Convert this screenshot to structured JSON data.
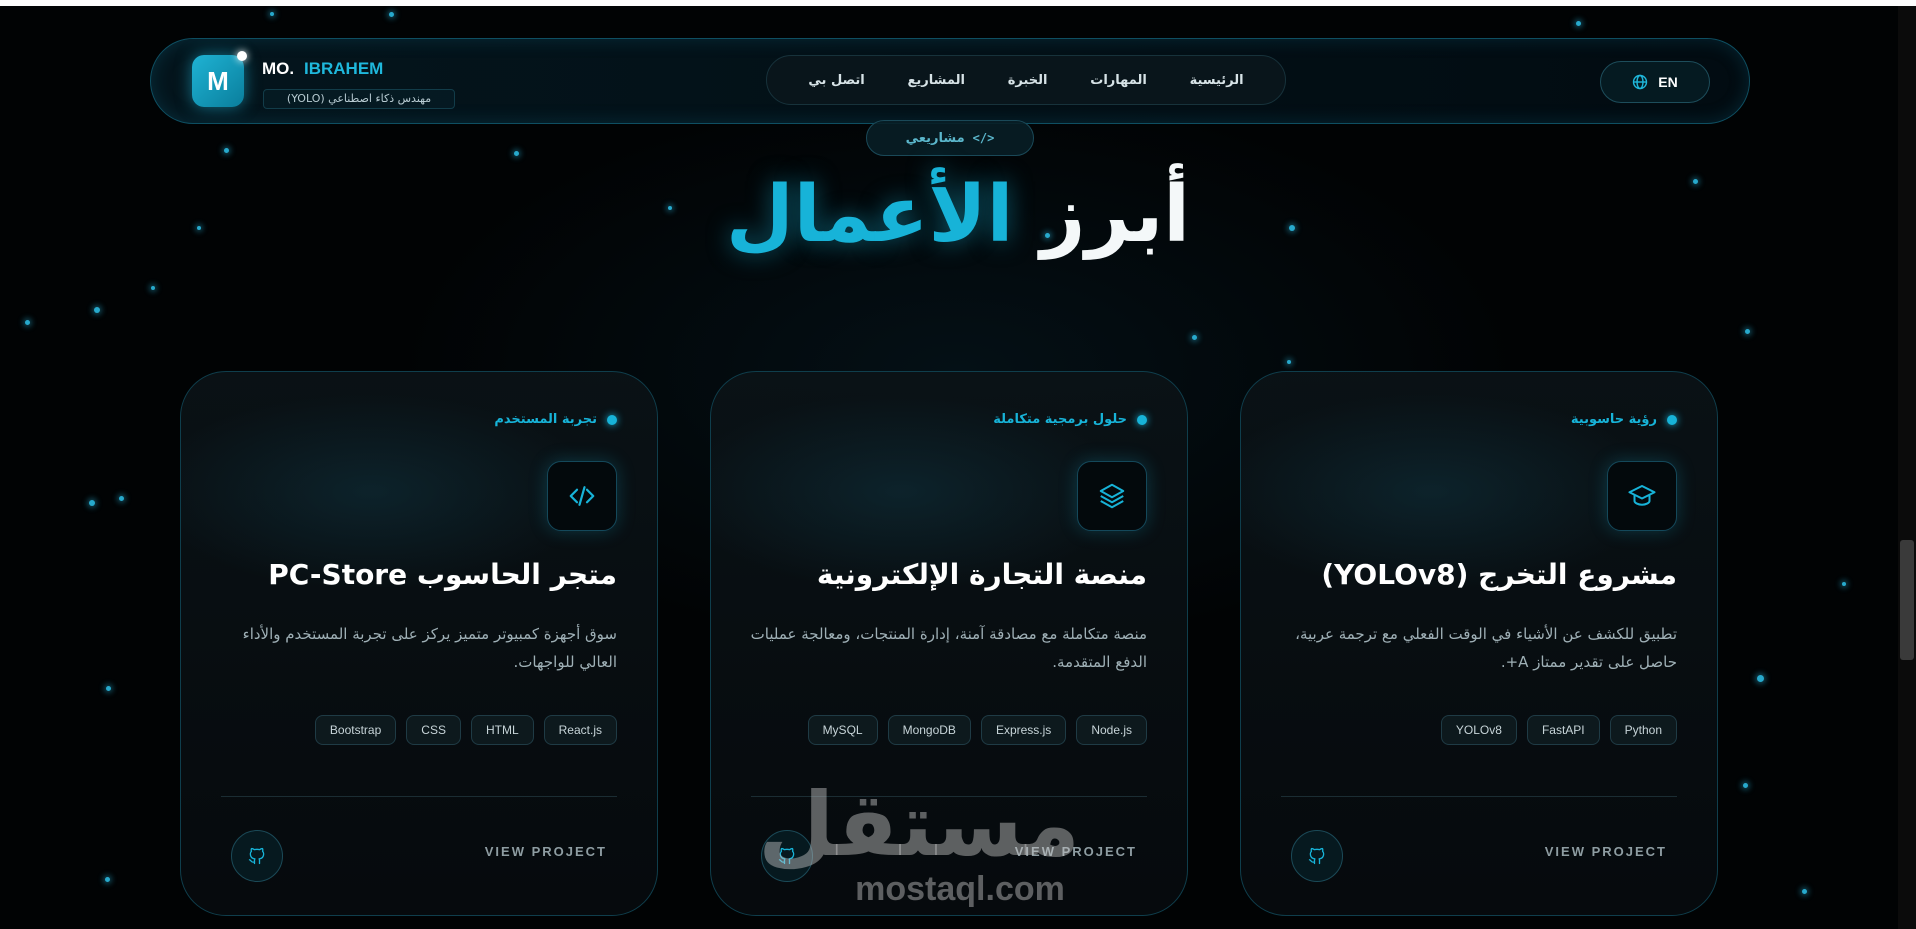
{
  "header": {
    "logo_letter": "M",
    "brand_first": "MO.",
    "brand_last": "IBRAHEM",
    "brand_subtitle": "مهندس ذكاء اصطناعي (YOLO)",
    "nav": [
      "الرئيسية",
      "المهارات",
      "الخبرة",
      "المشاريع",
      "اتصل بي"
    ],
    "lang_label": "EN"
  },
  "section": {
    "badge": "مشاريعي",
    "title_white": "أبرز",
    "title_accent": "الأعمال"
  },
  "projects": [
    {
      "category": "رؤية حاسوبية",
      "icon": "graduation-cap-icon",
      "title": "مشروع التخرج (YOLOv8)",
      "description": "تطبيق للكشف عن الأشياء في الوقت الفعلي مع ترجمة عربية، حاصل على تقدير ممتاز A+.",
      "tags": [
        "Python",
        "FastAPI",
        "YOLOv8"
      ],
      "view_label": "VIEW PROJECT"
    },
    {
      "category": "حلول برمجية متكاملة",
      "icon": "layers-icon",
      "title": "منصة التجارة الإلكترونية",
      "description": "منصة متكاملة مع مصادقة آمنة، إدارة المنتجات، ومعالجة عمليات الدفع المتقدمة.",
      "tags": [
        "Node.js",
        "Express.js",
        "MongoDB",
        "MySQL"
      ],
      "view_label": "VIEW PROJECT"
    },
    {
      "category": "تجربة المستخدم",
      "icon": "code-icon",
      "title": "متجر الحاسوب PC-Store",
      "description": "سوق أجهزة كمبيوتر متميز يركز على تجربة المستخدم والأداء العالي للواجهات.",
      "tags": [
        "React.js",
        "HTML",
        "CSS",
        "Bootstrap"
      ],
      "view_label": "VIEW PROJECT"
    }
  ],
  "watermark": {
    "arabic": "مستقل",
    "latin": "mostaql.com"
  },
  "colors": {
    "accent": "#17b3d8",
    "background": "#010304",
    "card_border": "#0f3e4c"
  }
}
